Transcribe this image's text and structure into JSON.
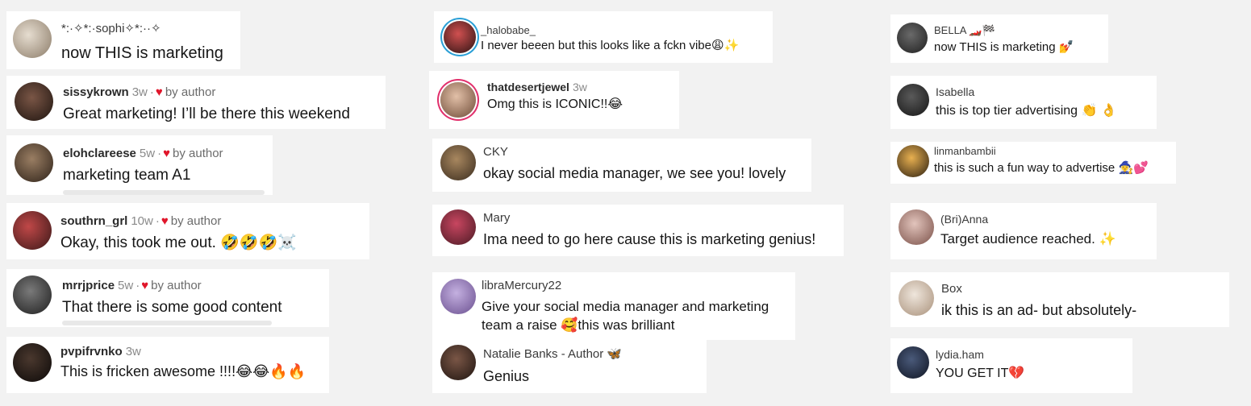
{
  "comments": [
    {
      "username": "*:·✧*:·sophi✧*:··✧",
      "time": "",
      "by_author": "",
      "text": "now THIS is marketing",
      "avatar_colors": [
        "#cfc6b8",
        "#7a6a58"
      ]
    },
    {
      "username": "sissykrown",
      "time": "3w",
      "by_author": "by author",
      "text": "Great marketing! I’ll be there this weekend",
      "avatar_colors": [
        "#6b4a3a",
        "#2a1b14"
      ]
    },
    {
      "username": "elohclareese",
      "time": "5w",
      "by_author": "by author",
      "text": "marketing team A1",
      "avatar_colors": [
        "#8a6f57",
        "#3b2c22"
      ]
    },
    {
      "username": "southrn_grl",
      "time": "10w",
      "by_author": "by author",
      "text": "Okay, this took me out. 🤣🤣🤣☠️",
      "avatar_colors": [
        "#b13a3a",
        "#3a1a1a"
      ]
    },
    {
      "username": "mrrjprice",
      "time": "5w",
      "by_author": "by author",
      "text": "That there is some good content",
      "avatar_colors": [
        "#6a6a6a",
        "#2a2a2a"
      ]
    },
    {
      "username": "pvpifrvnko",
      "time": "3w",
      "by_author": "",
      "text": "This is fricken awesome !!!!😂😂🔥🔥",
      "avatar_colors": [
        "#3a2a22",
        "#0f0b09"
      ]
    },
    {
      "username": "_halobabe_",
      "time": "",
      "by_author": "",
      "text": "I never beeen but this looks like a fckn vibe😩✨",
      "avatar_colors": [
        "#c84a4a",
        "#2a1212"
      ]
    },
    {
      "username": "thatdesertjewel",
      "time": "3w",
      "by_author": "",
      "text": "Omg this is ICONIC!!😂",
      "avatar_colors": [
        "#d9b39a",
        "#6d4a36"
      ]
    },
    {
      "username": "CKY",
      "time": "",
      "by_author": "",
      "text": "okay social media manager, we see you! lovely",
      "avatar_colors": [
        "#9a7a58",
        "#3a2c1e"
      ]
    },
    {
      "username": "Mary",
      "time": "",
      "by_author": "",
      "text": "Ima need to go here cause this is marketing genius!",
      "avatar_colors": [
        "#c0405a",
        "#4a1a24"
      ]
    },
    {
      "username": "libraMercury22",
      "time": "",
      "by_author": "",
      "text": "Give your social media manager and marketing",
      "text2": "team a raise 🥰this was brilliant",
      "avatar_colors": [
        "#b9a2d8",
        "#6a4f8f"
      ]
    },
    {
      "username": "Natalie Banks - Author 🦋",
      "time": "",
      "by_author": "",
      "text": "Genius",
      "avatar_colors": [
        "#6a4a3a",
        "#1e1410"
      ]
    },
    {
      "username": "BELLA 🏎️🏁",
      "time": "",
      "by_author": "",
      "text": "now THIS is marketing 💅",
      "avatar_colors": [
        "#5a5a5a",
        "#1e1e1e"
      ]
    },
    {
      "username": "Isabella",
      "time": "",
      "by_author": "",
      "text": "this is top tier advertising 👏 👌",
      "avatar_colors": [
        "#4a4a4a",
        "#151515"
      ]
    },
    {
      "username": "linmanbambii",
      "time": "",
      "by_author": "",
      "text": "this is such a fun way to advertise 🧙‍♀️💕",
      "avatar_colors": [
        "#e0a03a",
        "#2a1e10"
      ]
    },
    {
      "username": "(Bri)Anna",
      "time": "",
      "by_author": "",
      "text": "Target audience reached. ✨",
      "avatar_colors": [
        "#d8b8b0",
        "#7a5048"
      ]
    },
    {
      "username": "Box",
      "time": "",
      "by_author": "",
      "text": "ik this is an ad- but absolutely-",
      "avatar_colors": [
        "#e8dccf",
        "#a8907a"
      ]
    },
    {
      "username": "lydia.ham",
      "time": "",
      "by_author": "",
      "text": "YOU GET IT💔",
      "avatar_colors": [
        "#3a4a6a",
        "#0f1422"
      ]
    }
  ],
  "colors": {
    "heart": "#e0162b",
    "ring_instagram": "#e1306c",
    "ring_blue": "#2a9fd6"
  }
}
